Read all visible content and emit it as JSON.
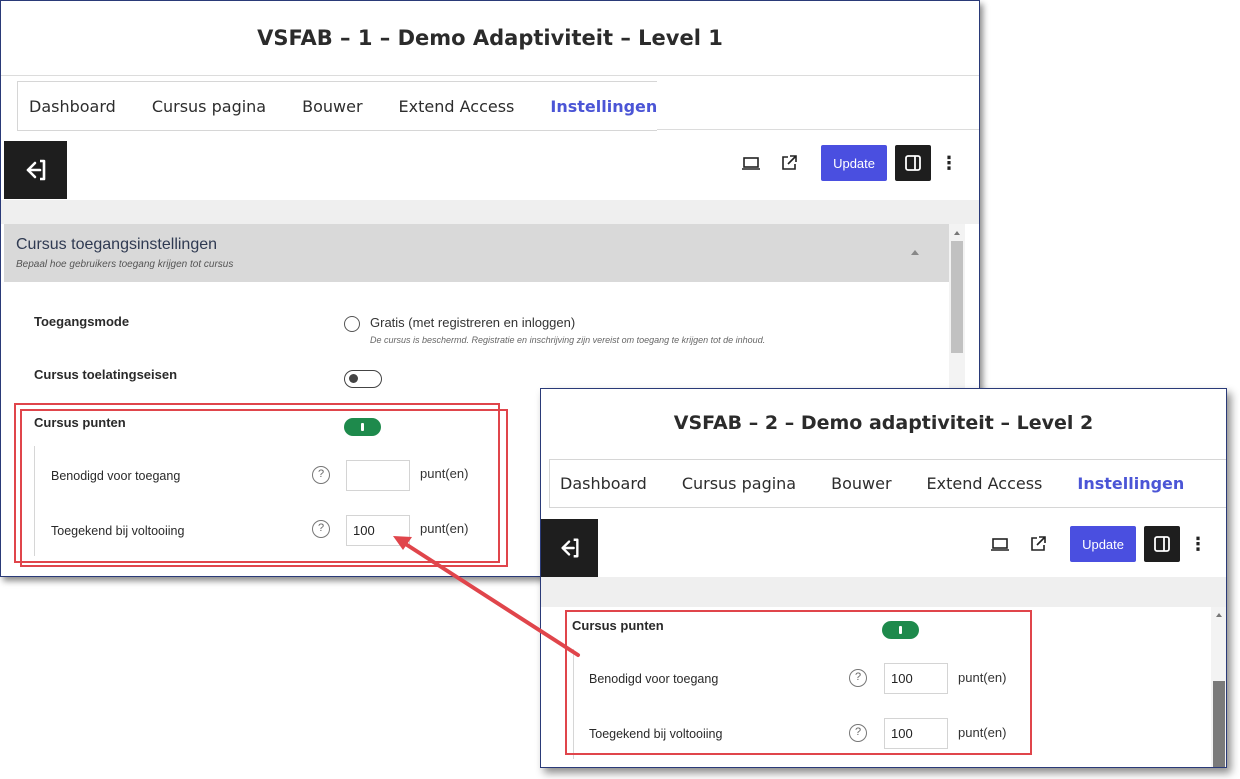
{
  "colors": {
    "accent": "#4a4fe0",
    "active_tab": "#4b55d6",
    "toggle_on": "#1e8a4c",
    "highlight": "#e0454b"
  },
  "window1": {
    "title": "VSFAB – 1 – Demo Adaptiviteit – Level 1",
    "tabs": [
      "Dashboard",
      "Cursus pagina",
      "Bouwer",
      "Extend Access",
      "Instellingen"
    ],
    "active_tab": "Instellingen",
    "toolbar": {
      "update_label": "Update",
      "icons": [
        "desktop-preview-icon",
        "external-link-icon",
        "sidebar-toggle-icon",
        "more-options-icon"
      ]
    },
    "section": {
      "title": "Cursus toegangsinstellingen",
      "subtitle": "Bepaal hoe gebruikers toegang krijgen tot cursus"
    },
    "access_mode": {
      "label": "Toegangsmode",
      "option": "Gratis (met registreren en inloggen)",
      "description": "De cursus is beschermd. Registratie en inschrijving zijn vereist om toegang te krijgen tot de inhoud.",
      "selected": false
    },
    "requirements": {
      "label": "Cursus toelatingseisen",
      "enabled": false
    },
    "points": {
      "label": "Cursus punten",
      "enabled": true,
      "required_label": "Benodigd voor toegang",
      "required_value": "",
      "awarded_label": "Toegekend bij voltooiing",
      "awarded_value": "100",
      "unit": "punt(en)"
    }
  },
  "window2": {
    "title": "VSFAB – 2 – Demo adaptiviteit – Level 2",
    "tabs": [
      "Dashboard",
      "Cursus pagina",
      "Bouwer",
      "Extend Access",
      "Instellingen"
    ],
    "active_tab": "Instellingen",
    "toolbar": {
      "update_label": "Update",
      "icons": [
        "desktop-preview-icon",
        "external-link-icon",
        "sidebar-toggle-icon",
        "more-options-icon"
      ]
    },
    "points": {
      "label": "Cursus punten",
      "enabled": true,
      "required_label": "Benodigd voor toegang",
      "required_value": "100",
      "awarded_label": "Toegekend bij voltooiing",
      "awarded_value": "100",
      "unit": "punt(en)"
    }
  },
  "help_glyph": "?",
  "more_glyph": "⋮"
}
